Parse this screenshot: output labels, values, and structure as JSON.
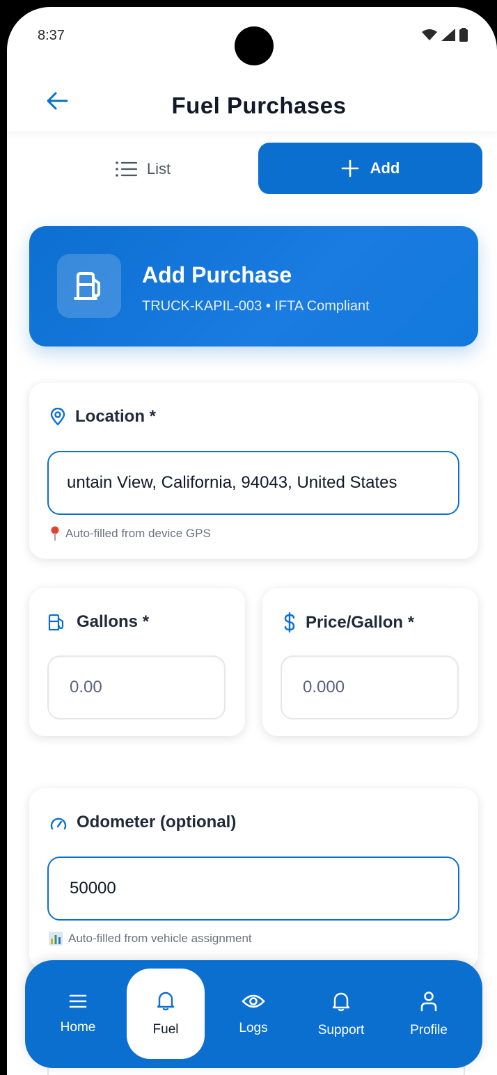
{
  "status_bar": {
    "time": "8:37"
  },
  "header": {
    "title": "Fuel Purchases"
  },
  "toggle": {
    "list_label": "List",
    "add_label": "Add"
  },
  "hero": {
    "title": "Add Purchase",
    "subtitle": "TRUCK-KAPIL-003 • IFTA Compliant"
  },
  "location": {
    "label": "Location *",
    "value": "untain View, California, 94043, United States",
    "hint": "Auto-filled from device GPS"
  },
  "gallons": {
    "label": "Gallons *",
    "placeholder": "0.00"
  },
  "price": {
    "label": "Price/Gallon *",
    "placeholder": "0.000"
  },
  "odometer": {
    "label": "Odometer (optional)",
    "value": "50000",
    "hint": "Auto-filled from vehicle assignment"
  },
  "nav": {
    "items": [
      {
        "label": "Home",
        "icon": "menu-icon"
      },
      {
        "label": "Fuel",
        "icon": "bell-icon",
        "active": true
      },
      {
        "label": "Logs",
        "icon": "eye-icon"
      },
      {
        "label": "Support",
        "icon": "bell-icon"
      },
      {
        "label": "Profile",
        "icon": "person-icon"
      }
    ]
  },
  "colors": {
    "primary": "#0b6fd0",
    "text": "#111827",
    "muted": "#6b7280"
  }
}
